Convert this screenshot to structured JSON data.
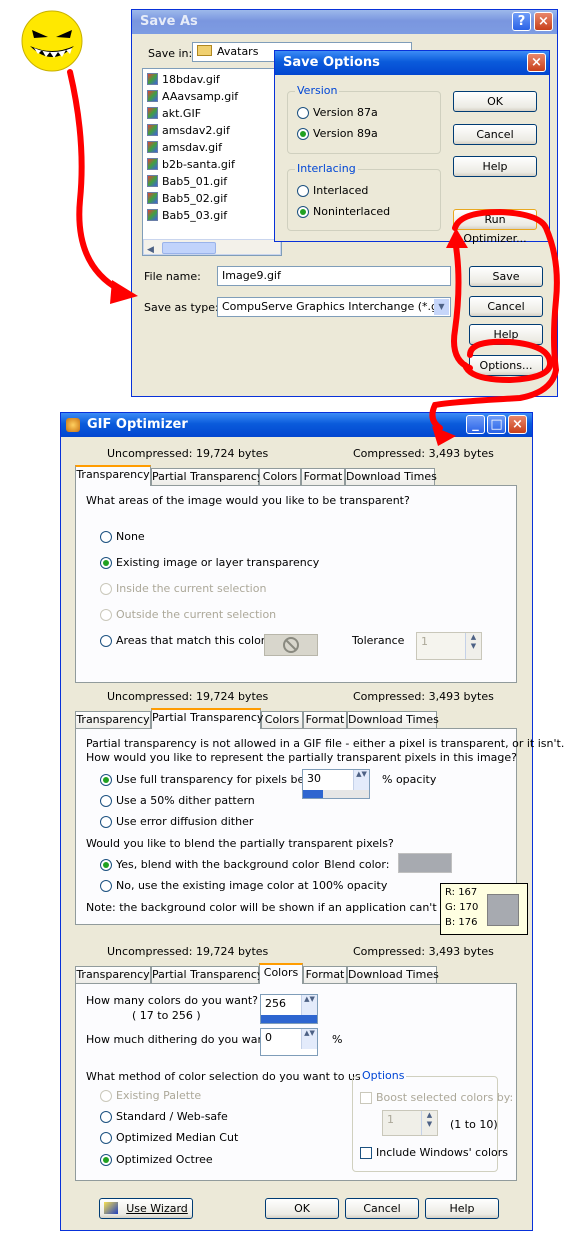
{
  "save_as": {
    "title": "Save As",
    "save_in_label": "Save in:",
    "save_in_value": "Avatars",
    "files": [
      "18bdav.gif",
      "AAavsamp.gif",
      "akt.GIF",
      "amsdav2.gif",
      "amsdav.gif",
      "b2b-santa.gif",
      "Bab5_01.gif",
      "Bab5_02.gif",
      "Bab5_03.gif"
    ],
    "file_name_label": "File name:",
    "file_name_value": "Image9.gif",
    "save_type_label": "Save as type:",
    "save_type_value": "CompuServe Graphics Interchange (*.gif)",
    "buttons": {
      "save": "Save",
      "cancel": "Cancel",
      "help": "Help",
      "options": "Options..."
    }
  },
  "save_options": {
    "title": "Save Options",
    "version_group": "Version",
    "version_87a": "Version 87a",
    "version_89a": "Version 89a",
    "interlacing_group": "Interlacing",
    "interlaced": "Interlaced",
    "noninterlaced": "Noninterlaced",
    "buttons": {
      "ok": "OK",
      "cancel": "Cancel",
      "help": "Help",
      "run_optimizer": "Run Optimizer..."
    }
  },
  "gif_optimizer": {
    "title": "GIF Optimizer",
    "uncompressed": "Uncompressed:  19,724 bytes",
    "compressed": "Compressed: 3,493 bytes",
    "tabs": [
      "Transparency",
      "Partial Transparency",
      "Colors",
      "Format",
      "Download Times"
    ],
    "transparency": {
      "question": "What areas of the image would you like to be transparent?",
      "opt_none": "None",
      "opt_existing": "Existing image or layer transparency",
      "opt_inside": "Inside the current selection",
      "opt_outside": "Outside the current selection",
      "opt_match": "Areas that match this color",
      "tolerance_label": "Tolerance",
      "tolerance_value": "1"
    },
    "partial": {
      "intro1": "Partial transparency is not allowed in a GIF file - either a pixel is transparent, or it isn't.",
      "intro2": "How would you like to represent the partially transparent pixels in this image?",
      "opt_full": "Use full transparency for pixels below",
      "opacity_value": "30",
      "opacity_unit": "% opacity",
      "opt_dither50": "Use a 50% dither pattern",
      "opt_error": "Use error diffusion dither",
      "blend_question": "Would you like to blend the partially transparent pixels?",
      "opt_blend_yes": "Yes, blend with the background color",
      "blend_color_label": "Blend color:",
      "opt_blend_no": "No, use the existing image color at 100% opacity",
      "note": "Note: the background color will be shown if an application can't display tran",
      "tooltip_r": "R: 167",
      "tooltip_g": "G: 170",
      "tooltip_b": "B: 176",
      "blend_color": "#a7aab0"
    },
    "colors": {
      "how_many": "How many colors do you want?",
      "range": "( 17  to  256 )",
      "colors_value": "256",
      "dithering": "How much dithering do you want?",
      "dither_value": "0",
      "dither_unit": "%",
      "method_question": "What method of color selection do you want to use?",
      "opt_existing": "Existing Palette",
      "opt_standard": "Standard / Web-safe",
      "opt_median": "Optimized Median Cut",
      "opt_octree": "Optimized Octree",
      "options_group": "Options",
      "boost": "Boost selected colors by:",
      "boost_value": "1",
      "boost_range": "(1 to 10)",
      "include_windows": "Include Windows' colors"
    },
    "buttons": {
      "wizard": "Use Wizard",
      "ok": "OK",
      "cancel": "Cancel",
      "help": "Help"
    }
  },
  "colors_accent": {
    "title_blue": "#0a5bdb",
    "annotation_red": "#ff0000",
    "selected_tab": "#ff9c00"
  }
}
